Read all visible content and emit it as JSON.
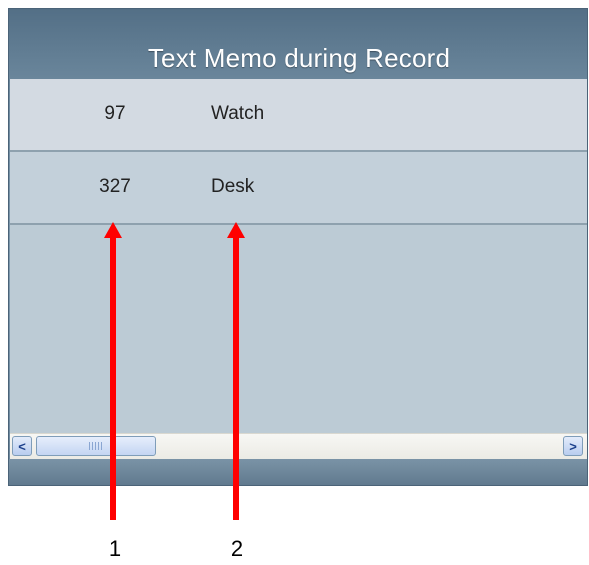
{
  "panel": {
    "title": "Text Memo during Record"
  },
  "memo_list": [
    {
      "number": "97",
      "name": "Watch"
    },
    {
      "number": "327",
      "name": "Desk"
    }
  ],
  "scrollbar": {
    "left_arrow": "<",
    "right_arrow": ">"
  },
  "callouts": {
    "label_1": "1",
    "label_2": "2"
  },
  "colors": {
    "arrow": "#ff0000",
    "panel": "#6f8ba0"
  }
}
